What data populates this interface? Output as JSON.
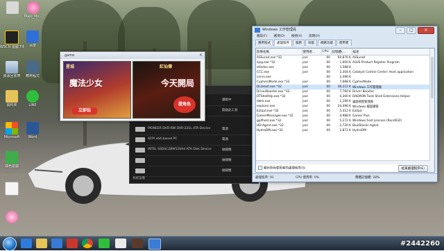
{
  "desktop": {
    "icons": [
      {
        "label": "",
        "name": "desktop-icon-top"
      },
      {
        "label": "Majo_Mo...",
        "name": "desktop-icon-majo"
      },
      {
        "label": "WSCN\n遊戲下載",
        "name": "desktop-icon-wscn"
      },
      {
        "label": "百度",
        "name": "desktop-icon-baidu"
      },
      {
        "label": "資源回收筒",
        "name": "desktop-icon-recycle"
      },
      {
        "label": "應用程式",
        "name": "desktop-icon-app"
      },
      {
        "label": "資料夾",
        "name": "desktop-icon-folder"
      },
      {
        "label": "LINE",
        "name": "desktop-icon-line"
      },
      {
        "label": "Microsoft",
        "name": "desktop-icon-office"
      },
      {
        "label": "Word",
        "name": "desktop-icon-word"
      },
      {
        "label": "綠色遊戲",
        "name": "desktop-icon-green"
      },
      {
        "label": "",
        "name": "desktop-icon-file"
      },
      {
        "label": "",
        "name": "desktop-icon-pink"
      }
    ],
    "watermark": "#2442260"
  },
  "game_window": {
    "title": "game",
    "banner1": {
      "logo": "星城",
      "headline": "魔法少女",
      "button": "立即玩"
    },
    "banner2": {
      "logo": "紅仙傳",
      "headline": "今天開局",
      "button": "提角色"
    }
  },
  "dark_window": {
    "rows": [
      {
        "name": "",
        "right": "讀取中"
      },
      {
        "name": "",
        "right": "開啟此工具"
      },
      {
        "name": "PIONEER DVD-RW DVR-221L ATA Device",
        "right": "電源"
      },
      {
        "name": "ACPI x64-based PC",
        "right": "電源"
      },
      {
        "name": "INTEL SSDSC2BW120A4 ATA Disk Device",
        "right": "磁碟機"
      },
      {
        "name": "",
        "right": "磁碟機"
      },
      {
        "name": "",
        "right": "磁碟機"
      }
    ],
    "footer": "系統設備"
  },
  "task_manager": {
    "title": "Windows 工作管理員",
    "menu": [
      "檔案(F)",
      "選項(O)",
      "檢視(V)",
      "說明(H)"
    ],
    "tabs": [
      "應用程式",
      "處理程序",
      "服務",
      "效能",
      "網路功能",
      "使用者"
    ],
    "active_tab": 1,
    "columns": [
      "影像名稱",
      "使用者...",
      "CPU",
      "記憶體(...",
      "描述"
    ],
    "rows": [
      [
        "ASSurad.exe *32",
        "jool",
        "00",
        "60,876 K",
        "ASSurad"
      ],
      [
        "ajsg.exe *32",
        "jool",
        "00",
        "1,600 K",
        "ASUS Product Register Program"
      ],
      [
        "atiedxx.exe",
        "jool",
        "00",
        "3,588 K",
        ""
      ],
      [
        "CCC.exe",
        "jool",
        "00",
        "2,304 K",
        "Catalyst Control Center: Host application"
      ],
      [
        "conrs.exe",
        "",
        "00",
        "2,496 K",
        ""
      ],
      [
        "CyphersMode.exe *32",
        "jool",
        "00",
        "7,688 K",
        "CypherMode"
      ],
      [
        "DLLHost.exe *32",
        "jool",
        "00",
        "36,212 K",
        "Windows 工作管理員"
      ],
      [
        "DriverBooster.exe *32",
        "jool",
        "00",
        "7,760 K",
        "Driver Booster"
      ],
      [
        "DTShellHlp.exe *32",
        "jool",
        "00",
        "4,300 K",
        "DAEMON Tools Shell Extensions Helper"
      ],
      [
        "dwm.exe",
        "jool",
        "00",
        "1,196 K",
        "桌面視窗管理員"
      ],
      [
        "explorer.exe",
        "jool",
        "00",
        "24,396 K",
        "Windows 檔案總管"
      ],
      [
        "EzUpd.exe *32",
        "jool",
        "00",
        "5,412 K",
        "EzUpd"
      ],
      [
        "GamerMessager.exe *32",
        "jool",
        "00",
        "4,988 K",
        "Gamer Plus"
      ],
      [
        "gpifhost.exe *32",
        "jool",
        "00",
        "5,272 K",
        "Windows host process (Rundll32)"
      ],
      [
        "HD-Agent.exe *32",
        "jool",
        "00",
        "2,720 K",
        "BlueStacks Agent"
      ],
      [
        "HydraDM.exe *32",
        "jool",
        "00",
        "2,872 K",
        "HydraDM"
      ]
    ],
    "selected_row": 6,
    "show_all_label": "顯示所有使用者的處理程序(S)",
    "end_button": "結束處理程序(E)",
    "status": {
      "processes": "處理程序: 91",
      "cpu": "CPU 使用率: 0%",
      "memory": "實體記憶體: 28%"
    },
    "window_buttons": {
      "min": "–",
      "max": "□",
      "close": "✕"
    }
  },
  "taskbar": {
    "items": [
      "ie-icon",
      "explorer-icon",
      "media-icon",
      "red-icon",
      "chrome-icon",
      "line-icon",
      "check-icon",
      "game-icon",
      "taskmgr-icon"
    ]
  }
}
